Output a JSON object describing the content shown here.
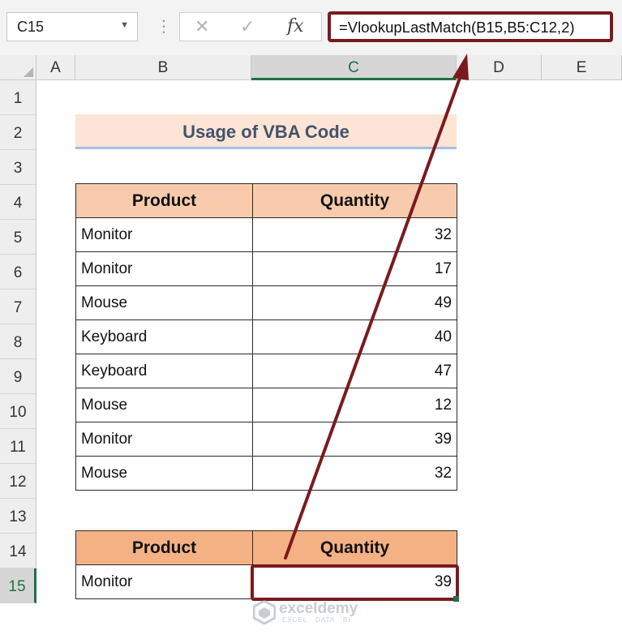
{
  "formula_bar": {
    "name_box": "C15",
    "separator": "⋮",
    "cancel_icon": "✕",
    "enter_icon": "✓",
    "fx_label": "fx",
    "formula": "=VlookupLastMatch(B15,B5:C12,2)"
  },
  "columns": [
    "A",
    "B",
    "C",
    "D",
    "E"
  ],
  "rows": [
    "1",
    "2",
    "3",
    "4",
    "5",
    "6",
    "7",
    "8",
    "9",
    "10",
    "11",
    "12",
    "13",
    "14",
    "15"
  ],
  "selected": {
    "column": "C",
    "row": "15"
  },
  "sheet": {
    "title": "Usage of VBA Code",
    "table": {
      "headers": [
        "Product",
        "Quantity"
      ],
      "rows": [
        [
          "Monitor",
          "32"
        ],
        [
          "Monitor",
          "17"
        ],
        [
          "Mouse",
          "49"
        ],
        [
          "Keyboard",
          "40"
        ],
        [
          "Keyboard",
          "47"
        ],
        [
          "Mouse",
          "12"
        ],
        [
          "Monitor",
          "39"
        ],
        [
          "Mouse",
          "32"
        ]
      ]
    },
    "result_table": {
      "headers": [
        "Product",
        "Quantity"
      ],
      "row": [
        "Monitor",
        "39"
      ]
    }
  },
  "watermark": {
    "name": "exceldemy",
    "tagline": "EXCEL · DATA · BI"
  },
  "colors": {
    "highlight": "#7b1a1e",
    "header_fill": "#f8cbad",
    "result_header_fill": "#f4b183",
    "title_fill": "#fce4d6",
    "excel_green": "#1f7145"
  }
}
